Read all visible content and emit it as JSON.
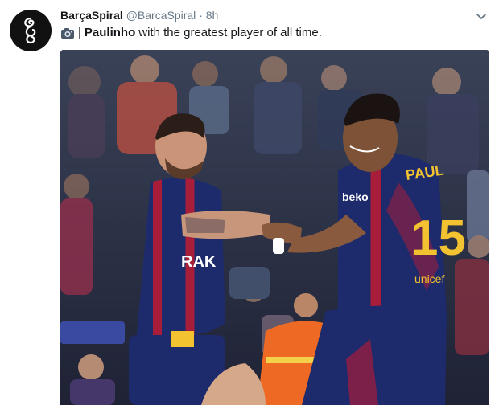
{
  "tweet": {
    "display_name": "BarçaSpiral",
    "handle": "@BarcaSpiral",
    "separator": "·",
    "time": "8h",
    "text_prefix": "|",
    "text_bold": "Paulinho",
    "text_rest": "with the greatest player of all time.",
    "icons": {
      "avatar": "spiral-logo",
      "menu": "chevron-down-icon",
      "emoji": "camera-icon"
    }
  },
  "photo": {
    "shirt_back_name": "PAUL",
    "shirt_number": "15",
    "sponsor": "beko",
    "shorts_text": "unicef",
    "chest_text": "RAK"
  },
  "colors": {
    "text": "#14171a",
    "secondary": "#657786",
    "barca_blue": "#1d2a6b",
    "barca_red": "#a71d3a",
    "gold": "#f2c230"
  }
}
